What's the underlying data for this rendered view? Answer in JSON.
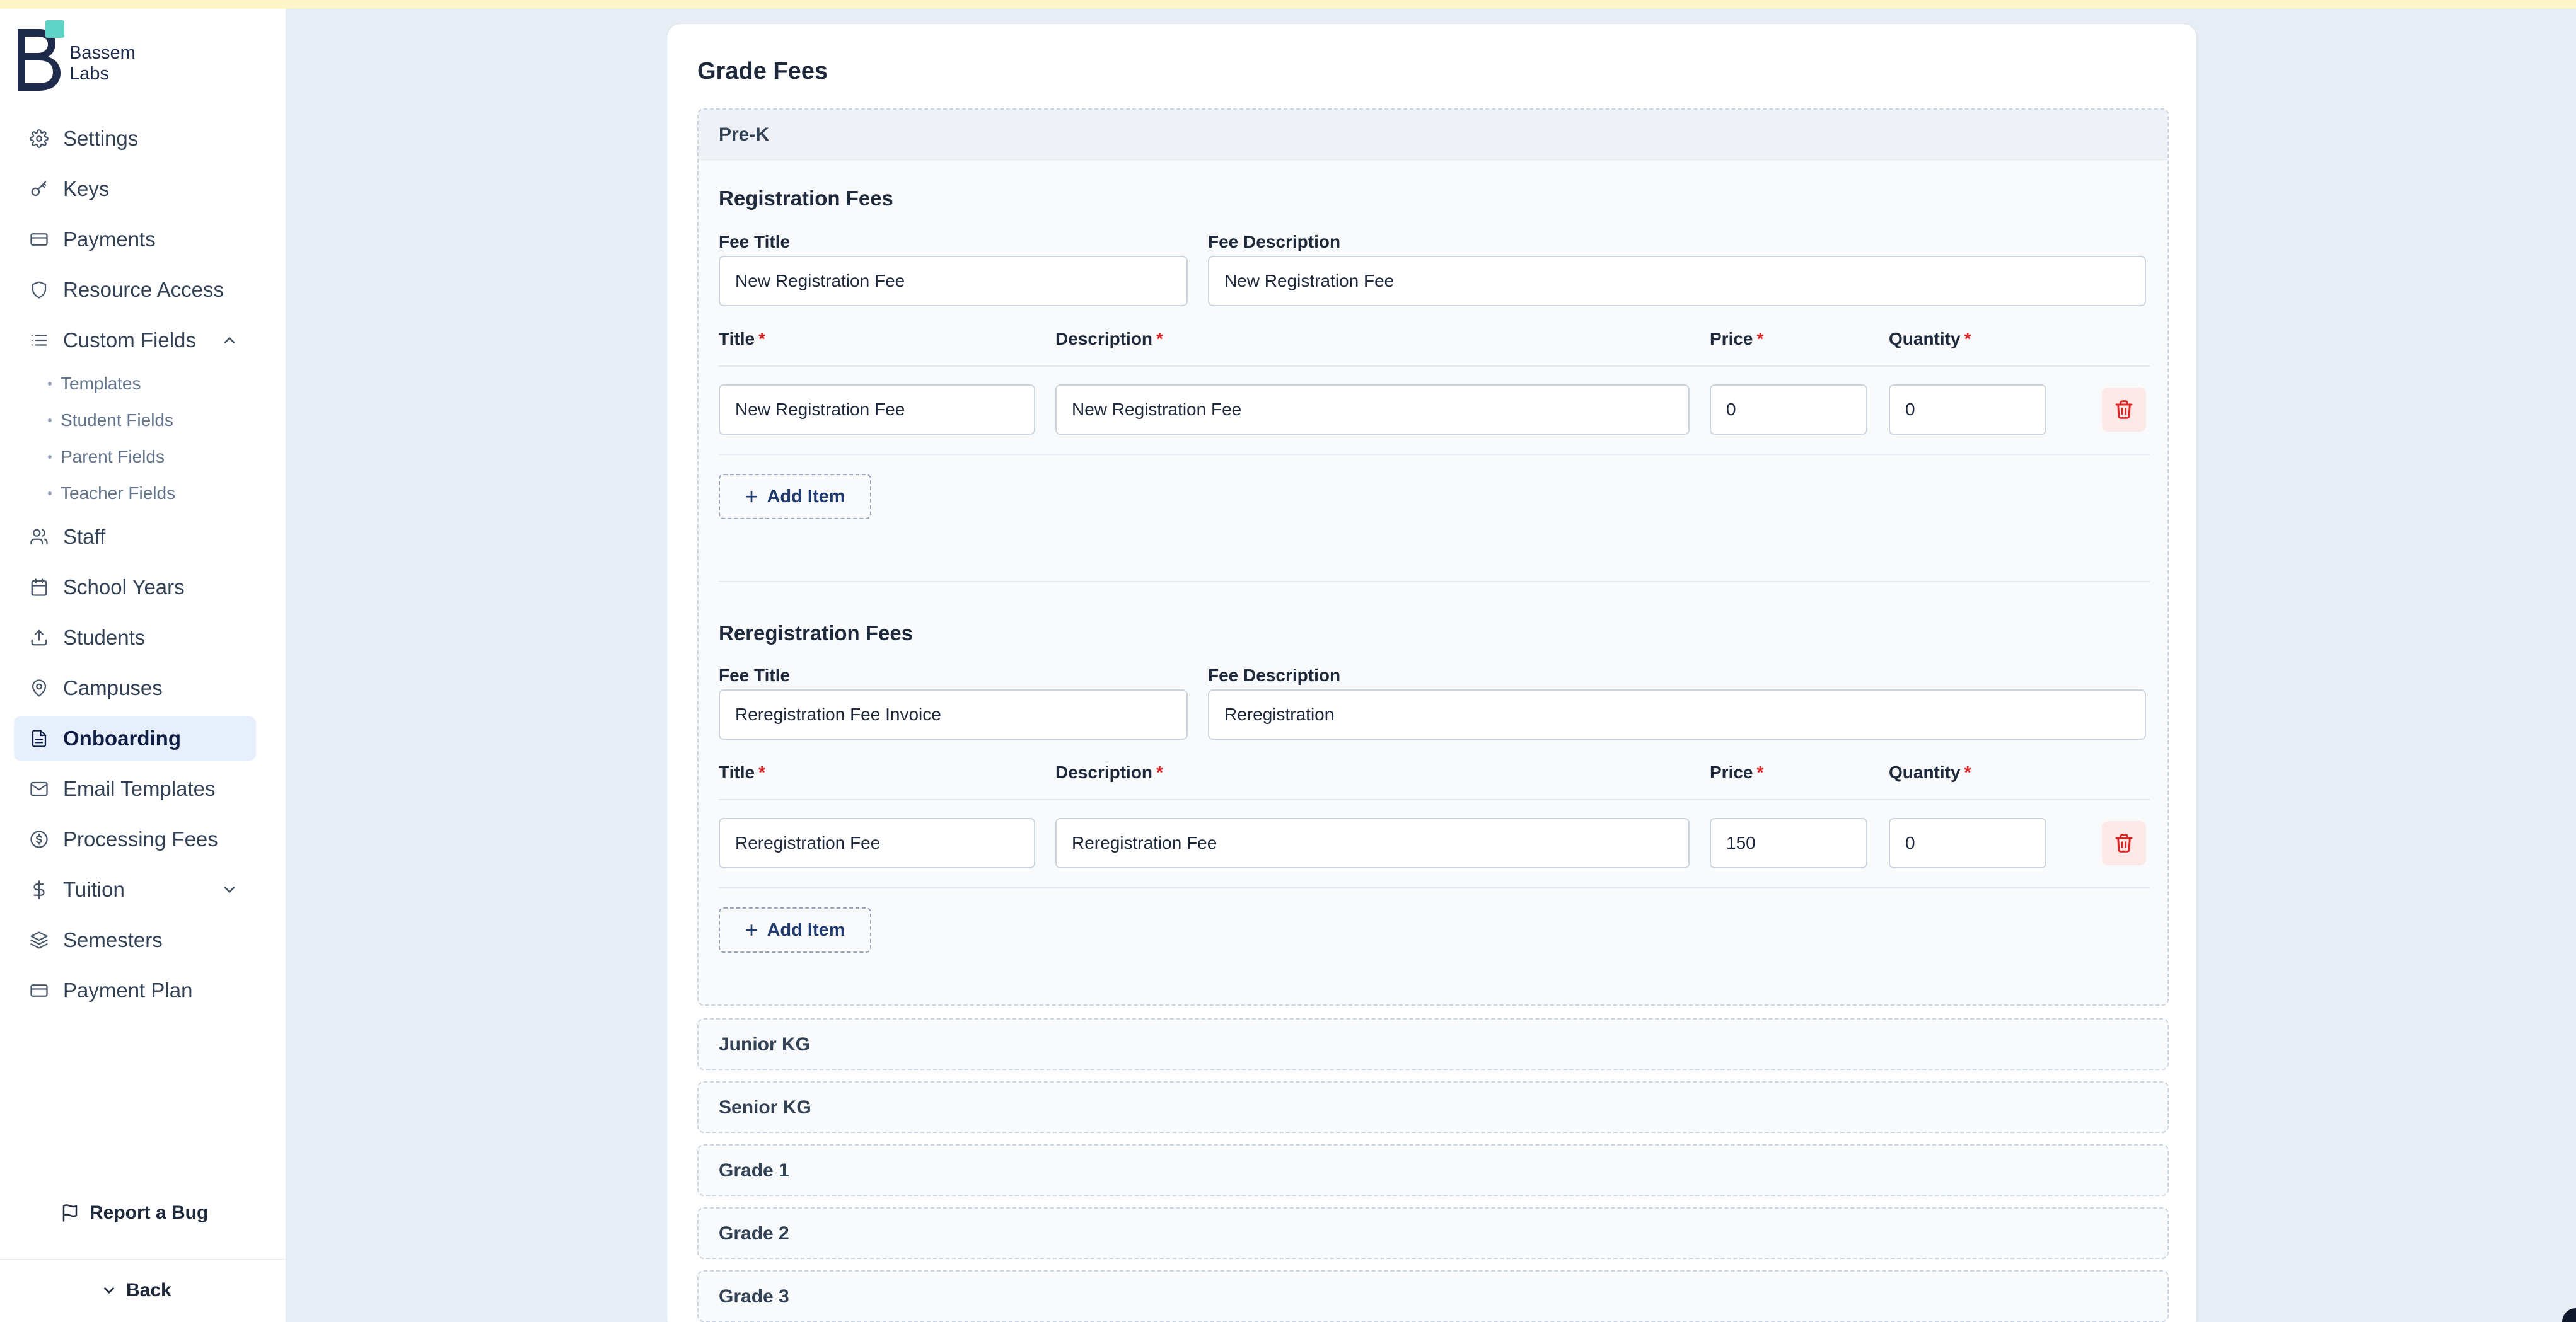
{
  "brand": {
    "name_line1": "Bassem",
    "name_line2": "Labs"
  },
  "sidebar": {
    "items": [
      {
        "label": "Settings",
        "icon": "gear-icon"
      },
      {
        "label": "Keys",
        "icon": "key-icon"
      },
      {
        "label": "Payments",
        "icon": "credit-card-icon"
      },
      {
        "label": "Resource Access",
        "icon": "shield-icon"
      },
      {
        "label": "Custom Fields",
        "icon": "list-icon",
        "expanded": true
      },
      {
        "label": "Staff",
        "icon": "users-icon"
      },
      {
        "label": "School Years",
        "icon": "calendar-icon"
      },
      {
        "label": "Students",
        "icon": "upload-icon"
      },
      {
        "label": "Campuses",
        "icon": "map-pin-icon"
      },
      {
        "label": "Onboarding",
        "icon": "document-icon",
        "active": true
      },
      {
        "label": "Email Templates",
        "icon": "mail-icon"
      },
      {
        "label": "Processing Fees",
        "icon": "coin-icon"
      },
      {
        "label": "Tuition",
        "icon": "dollar-icon",
        "expanded": false
      },
      {
        "label": "Semesters",
        "icon": "layers-icon"
      },
      {
        "label": "Payment Plan",
        "icon": "credit-card-icon"
      }
    ],
    "custom_fields_sub": [
      "Templates",
      "Student Fields",
      "Parent Fields",
      "Teacher Fields"
    ],
    "report_bug": "Report a Bug",
    "back": "Back"
  },
  "main": {
    "title": "Grade Fees",
    "open_grade": {
      "name": "Pre-K",
      "sections": [
        {
          "title": "Registration Fees",
          "fee_title_label": "Fee Title",
          "fee_title_value": "New Registration Fee",
          "fee_desc_label": "Fee Description",
          "fee_desc_value": "New Registration Fee",
          "columns": {
            "title": "Title",
            "description": "Description",
            "price": "Price",
            "quantity": "Quantity",
            "required_mark": "*"
          },
          "row": {
            "title": "New Registration Fee",
            "description": "New Registration Fee",
            "price": "0",
            "quantity": "0"
          },
          "add_item": "Add Item"
        },
        {
          "title": "Reregistration Fees",
          "fee_title_label": "Fee Title",
          "fee_title_value": "Reregistration Fee Invoice",
          "fee_desc_label": "Fee Description",
          "fee_desc_value": "Reregistration",
          "columns": {
            "title": "Title",
            "description": "Description",
            "price": "Price",
            "quantity": "Quantity",
            "required_mark": "*"
          },
          "row": {
            "title": "Reregistration Fee",
            "description": "Reregistration Fee",
            "price": "150",
            "quantity": "0"
          },
          "add_item": "Add Item"
        }
      ]
    },
    "collapsed_grades": [
      "Junior KG",
      "Senior KG",
      "Grade 1",
      "Grade 2",
      "Grade 3"
    ]
  },
  "colors": {
    "accent": "#1e3a6e",
    "required": "#dc2626",
    "active_bg": "#e6effb",
    "delete_bg": "#fde8e8"
  }
}
